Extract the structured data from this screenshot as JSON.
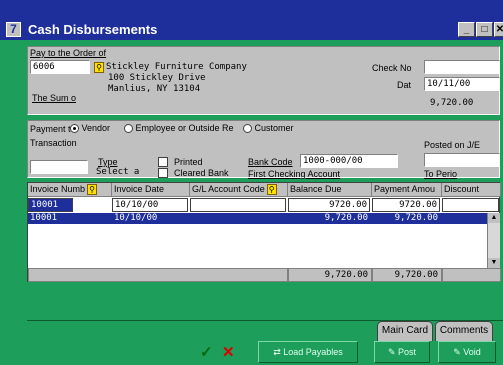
{
  "window": {
    "title": "Cash Disbursements",
    "logo": "7"
  },
  "payee": {
    "label": "Pay to the Order of",
    "code": "6006",
    "name": "Stickley Furniture Company",
    "address1": "100 Stickley Drive",
    "address2": "Manlius,  NY 13104",
    "sum_label": "The Sum o",
    "check_no_label": "Check No",
    "check_no": "",
    "date_label": "Dat",
    "date": "10/11/00",
    "amount": "9,720.00"
  },
  "payment": {
    "payment_to_label": "Payment t",
    "options": [
      "Vendor",
      "Employee or Outside Re",
      "Customer"
    ],
    "selected": "Vendor",
    "transaction_label": "Transaction",
    "type_label": "Type",
    "type_value": "Select a",
    "printed_label": "Printed",
    "cleared_label": "Cleared Bank",
    "bank_code_label": "Bank Code",
    "bank_code": "1000-000/00",
    "bank_name": "First Checking Account",
    "posted_label": "Posted on J/E",
    "period_label": "To Perio"
  },
  "grid": {
    "headers": [
      "Invoice Numb",
      "Invoice Date",
      "G/L Account Code",
      "Balance Due",
      "Payment Amou",
      "Discount"
    ],
    "edit_row": [
      "10001",
      "10/10/00",
      "",
      "9720.00",
      "9720.00",
      ""
    ],
    "rows": [
      [
        "10001",
        "10/10/00",
        "",
        "9,720.00",
        "9,720.00",
        ""
      ]
    ],
    "totals": {
      "balance": "9,720.00",
      "payment": "9,720.00"
    }
  },
  "tabs": [
    "Main Card",
    "Comments"
  ],
  "buttons": {
    "load_payables": "Load Payables",
    "post": "Post",
    "void": "Void"
  },
  "colors": {
    "titlebar": "#1e2f9c",
    "selection": "#1e2f9c",
    "background": "#1e9e5b"
  }
}
